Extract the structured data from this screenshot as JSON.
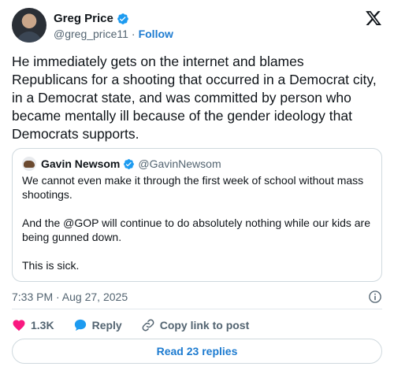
{
  "author": {
    "name": "Greg Price",
    "handle": "@greg_price11",
    "separator": "·",
    "follow_label": "Follow"
  },
  "tweet": {
    "text": "He immediately gets on the internet and blames Republicans for a shooting that occurred in a Democrat city, in a Democrat state, and was committed by person who became mentally ill because of the gender ideology that Democrats supports."
  },
  "quote": {
    "name": "Gavin Newsom",
    "handle": "@GavinNewsom",
    "paragraphs": [
      "We cannot even make it through the first week of school without mass shootings.",
      "And the @GOP will continue to do absolutely nothing while our kids are being gunned down.",
      "This is sick."
    ]
  },
  "meta": {
    "timestamp": "7:33 PM · Aug 27, 2025"
  },
  "actions": {
    "like_count": "1.3K",
    "reply_label": "Reply",
    "copy_link_label": "Copy link to post"
  },
  "read_replies_label": "Read 23 replies",
  "icons": {
    "verified": "verified-badge-icon",
    "x_logo": "x-logo-icon",
    "info": "info-icon",
    "like": "heart-icon",
    "reply": "speech-bubble-icon",
    "copy_link": "link-icon"
  },
  "colors": {
    "accent": "#1d7bd0",
    "like": "#f91880",
    "reply": "#1d9bf0",
    "muted": "#536471",
    "border": "#cfd9de"
  }
}
